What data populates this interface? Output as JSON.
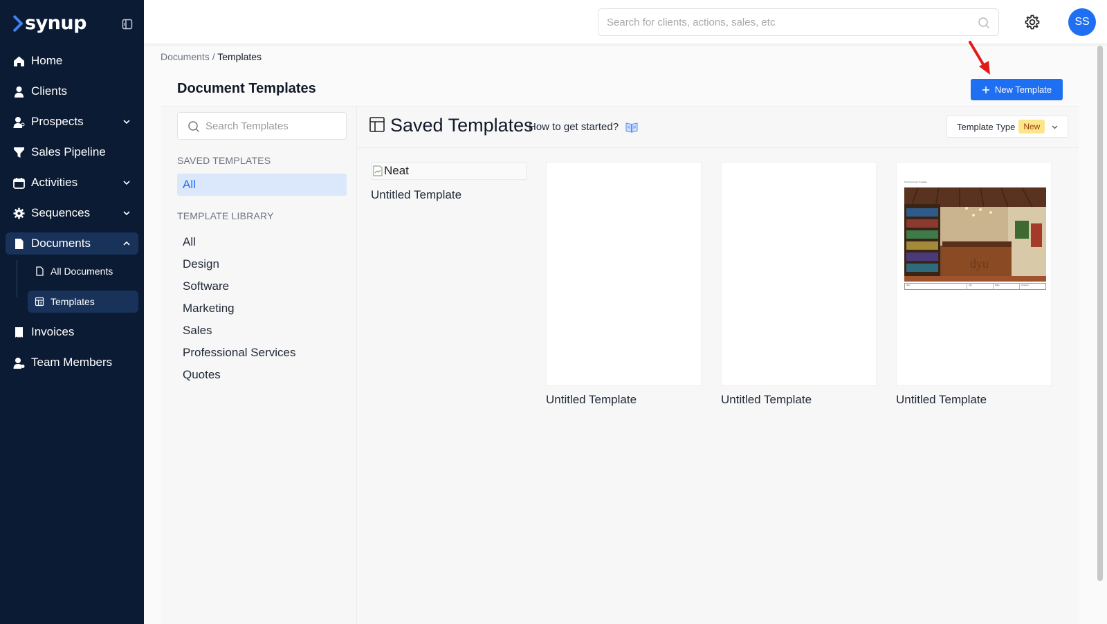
{
  "sidebar": {
    "logo_text": "synup",
    "items": [
      {
        "label": "Home",
        "icon": "home-icon"
      },
      {
        "label": "Clients",
        "icon": "user-icon"
      },
      {
        "label": "Prospects",
        "icon": "user-search-icon"
      },
      {
        "label": "Sales Pipeline",
        "icon": "funnel-icon"
      },
      {
        "label": "Activities",
        "icon": "calendar-icon"
      },
      {
        "label": "Sequences",
        "icon": "gear-icon"
      },
      {
        "label": "Documents",
        "icon": "document-icon"
      },
      {
        "label": "Invoices",
        "icon": "receipt-icon"
      },
      {
        "label": "Team Members",
        "icon": "team-icon"
      }
    ],
    "documents_sub": [
      {
        "label": "All Documents",
        "icon": "file-icon"
      },
      {
        "label": "Templates",
        "icon": "template-icon"
      }
    ]
  },
  "header": {
    "search_placeholder": "Search for clients, actions, sales, etc",
    "avatar_initials": "SS"
  },
  "breadcrumb": {
    "parent": "Documents",
    "separator": "/",
    "current": "Templates"
  },
  "page": {
    "title": "Document Templates",
    "new_button": "New Template",
    "template_search_placeholder": "Search Templates"
  },
  "filters": {
    "saved_heading": "SAVED TEMPLATES",
    "saved_all": "All",
    "library_heading": "TEMPLATE LIBRARY",
    "library_items": [
      "All",
      "Design",
      "Software",
      "Marketing",
      "Sales",
      "Professional Services",
      "Quotes"
    ]
  },
  "saved": {
    "title": "Saved Templates",
    "help_link": "How to get started?",
    "type_label": "Template Type",
    "type_badge": "New"
  },
  "cards": [
    {
      "name": "Untitled Template",
      "alt": "Neat"
    },
    {
      "name": "Untitled Template"
    },
    {
      "name": "Untitled Template"
    },
    {
      "name": "Untitled Template",
      "preview_title": "Test Document Template",
      "table_headers": [
        "Item",
        "Qty",
        "Rate",
        "Amount"
      ]
    }
  ],
  "colors": {
    "sidebar_bg": "#0b1b33",
    "accent": "#1f6ff2",
    "badge_bg": "#fde68a"
  }
}
